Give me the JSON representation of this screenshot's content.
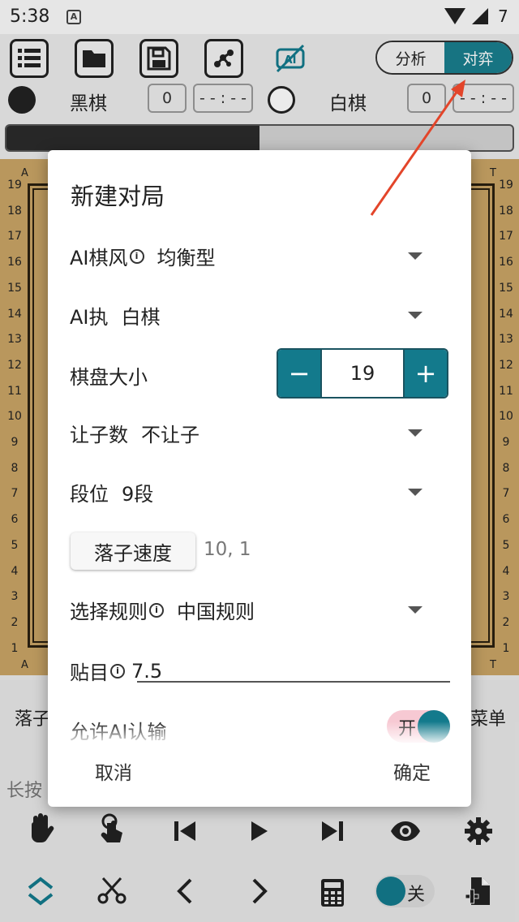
{
  "status_bar": {
    "time": "5:38",
    "notification_glyph": "A",
    "battery_glyph": "7"
  },
  "toolbar": {
    "segment_analyze": "分析",
    "segment_play": "对弈"
  },
  "players": {
    "black_label": "黑棋",
    "black_captures": "0",
    "black_time": "- - : - -",
    "white_label": "白棋",
    "white_captures": "0",
    "white_time": "- - : - -"
  },
  "win_bar": {
    "black_fraction": 0.5
  },
  "board": {
    "rows": [
      "19",
      "18",
      "17",
      "16",
      "15",
      "14",
      "13",
      "12",
      "11",
      "10",
      "9",
      "8",
      "7",
      "6",
      "5",
      "4",
      "3",
      "2",
      "1"
    ],
    "col_first": "A",
    "col_last": "T"
  },
  "lower": {
    "left_tab": "落子",
    "right_tab": "菜单",
    "hint": "长按",
    "toggle_label": "关"
  },
  "dialog": {
    "title": "新建对局",
    "ai_style_label": "AI棋风",
    "ai_style_value": "均衡型",
    "ai_color_label": "AI执",
    "ai_color_value": "白棋",
    "board_size_label": "棋盘大小",
    "board_size_value": "19",
    "minus": "−",
    "plus": "+",
    "handicap_label": "让子数",
    "handicap_value": "不让子",
    "rank_label": "段位",
    "rank_value": "9段",
    "speed_button": "落子速度",
    "speed_value": "10, 1",
    "rules_label": "选择规则",
    "rules_value": "中国规则",
    "komi_label": "贴目",
    "komi_value": "7.5",
    "resign_label": "允许AI认输",
    "resign_toggle": "开",
    "cancel": "取消",
    "ok": "确定",
    "info_glyph": "i"
  },
  "colors": {
    "accent": "#137a8c",
    "board": "#c9a465",
    "arrow": "#e3452a"
  }
}
